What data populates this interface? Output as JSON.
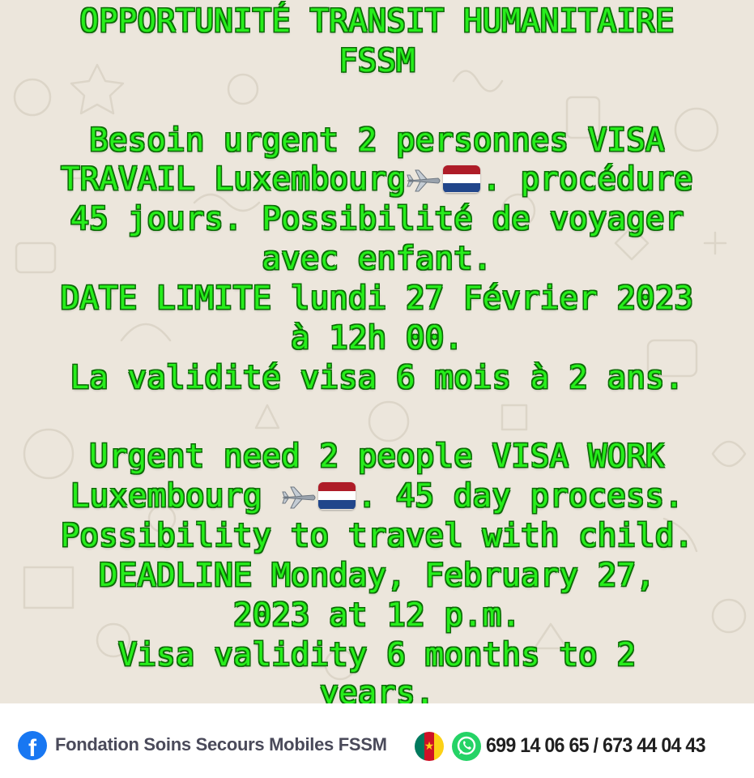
{
  "poster": {
    "title_line1": "OPPORTUNITÉ TRANSIT HUMANITAIRE",
    "title_line2": "FSSM",
    "fr": {
      "line1": "Besoin urgent 2 personnes VISA",
      "line2_a": "TRAVAIL Luxembourg",
      "line2_b": ". procédure",
      "line3": "45 jours. Possibilité de voyager",
      "line4": "avec enfant.",
      "line5": "DATE LIMITE lundi 27 Février 2023",
      "line6": "à 12h 00.",
      "line7": "La validité visa 6 mois à 2 ans."
    },
    "en": {
      "line1": "Urgent need 2 people VISA WORK",
      "line2_a": "Luxembourg ",
      "line2_b": ".  45 day process.",
      "line3": "Possibility to travel with child.",
      "line4": " DEADLINE Monday, February 27,",
      "line5": "2023 at 12 p.m.",
      "line6": " Visa validity 6 months to 2",
      "line7": "years."
    },
    "icons": {
      "plane": "airplane-icon",
      "flag": "netherlands-flag-icon"
    },
    "colors": {
      "text": "#27ee1c",
      "flag_red": "#ae1c28",
      "flag_white": "#ffffff",
      "flag_blue": "#21468b"
    }
  },
  "footer": {
    "facebook_icon": "facebook-icon",
    "organization": "Fondation Soins Secours Mobiles FSSM",
    "cameroon_flag_icon": "cameroon-flag-icon",
    "whatsapp_icon": "whatsapp-icon",
    "phones": "699 14 06 65 / 673 44 04 43"
  }
}
